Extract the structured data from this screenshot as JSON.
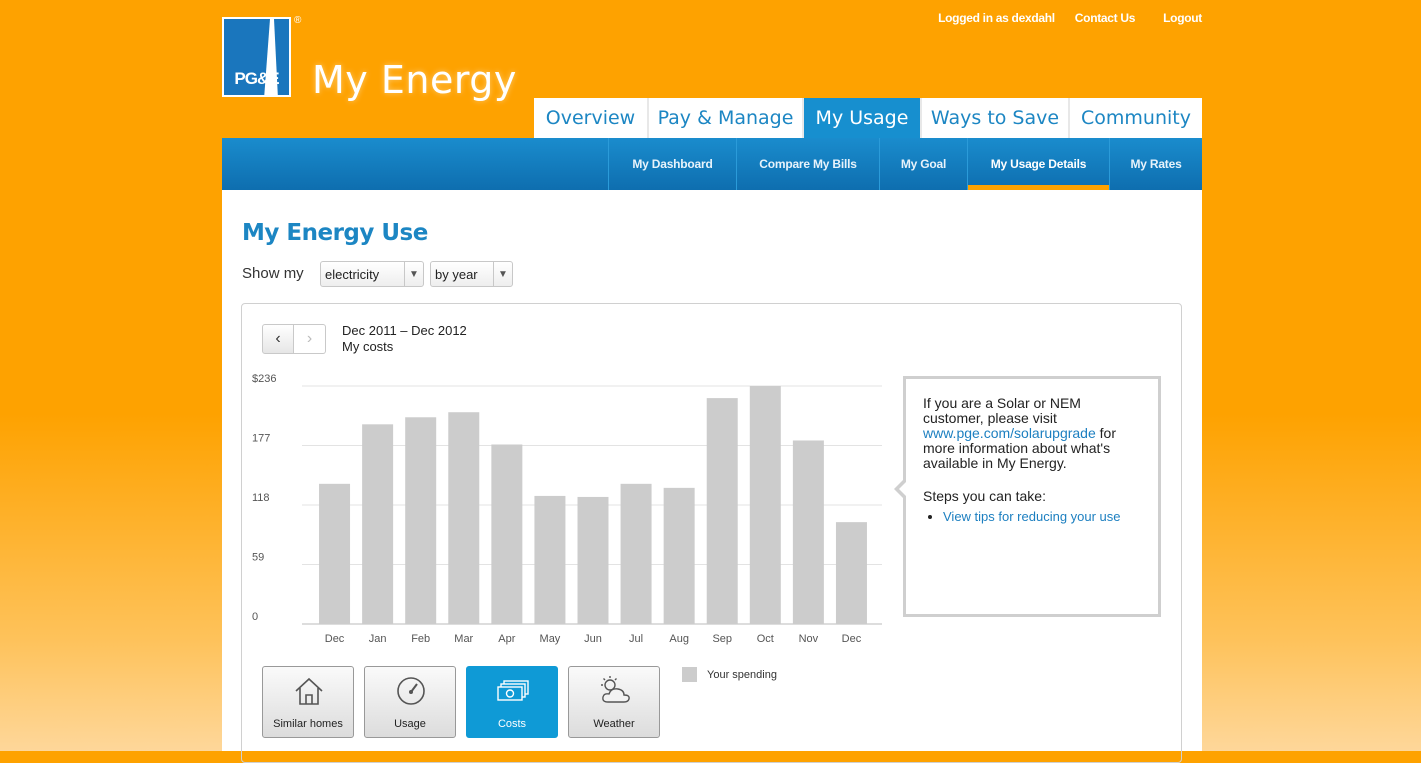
{
  "brand": {
    "logo_text": "PG&E",
    "registered": "®",
    "app_title": "My Energy"
  },
  "util_links": {
    "logged_in": "Logged in as dexdahl",
    "contact": "Contact Us",
    "logout": "Logout"
  },
  "main_tabs": [
    {
      "label": "Overview",
      "active": false
    },
    {
      "label": "Pay & Manage",
      "active": false
    },
    {
      "label": "My Usage",
      "active": true
    },
    {
      "label": "Ways to Save",
      "active": false
    },
    {
      "label": "Community",
      "active": false
    }
  ],
  "sub_tabs": [
    {
      "label": "My Dashboard",
      "active": false
    },
    {
      "label": "Compare My Bills",
      "active": false
    },
    {
      "label": "My Goal",
      "active": false
    },
    {
      "label": "My Usage Details",
      "active": true
    },
    {
      "label": "My Rates",
      "active": false
    }
  ],
  "page": {
    "title": "My Energy Use",
    "show_my": "Show my",
    "fuel_select": "electricity",
    "period_select": "by year"
  },
  "chart_header": {
    "range": "Dec 2011 – Dec 2012",
    "metric": "My costs"
  },
  "chart_data": {
    "type": "bar",
    "title": "",
    "xlabel": "",
    "ylabel": "",
    "y_tick_labels": [
      "0",
      "59",
      "118",
      "177",
      "$236"
    ],
    "y_ticks": [
      0,
      59,
      118,
      177,
      236
    ],
    "ylim": [
      0,
      236
    ],
    "grid": true,
    "categories": [
      "Dec",
      "Jan",
      "Feb",
      "Mar",
      "Apr",
      "May",
      "Jun",
      "Jul",
      "Aug",
      "Sep",
      "Oct",
      "Nov",
      "Dec"
    ],
    "series": [
      {
        "name": "Your spending",
        "values": [
          139,
          198,
          205,
          210,
          178,
          127,
          126,
          139,
          135,
          224,
          236,
          182,
          101
        ]
      }
    ]
  },
  "info_box": {
    "text_before": "If you are a Solar or NEM customer, please visit",
    "link": "www.pge.com/solarupgrade",
    "text_after": "for more information about what's available in My Energy.",
    "steps_heading": "Steps you can take:",
    "step_link": "View tips for reducing your use"
  },
  "view_buttons": [
    {
      "label": "Similar homes",
      "icon": "house-icon",
      "active": false
    },
    {
      "label": "Usage",
      "icon": "gauge-icon",
      "active": false
    },
    {
      "label": "Costs",
      "icon": "money-icon",
      "active": true
    },
    {
      "label": "Weather",
      "icon": "weather-icon",
      "active": false
    }
  ],
  "legend": {
    "label": "Your spending"
  },
  "colors": {
    "background": "#fea200",
    "accent_blue": "#178fcf",
    "bar": "#cccccc"
  }
}
